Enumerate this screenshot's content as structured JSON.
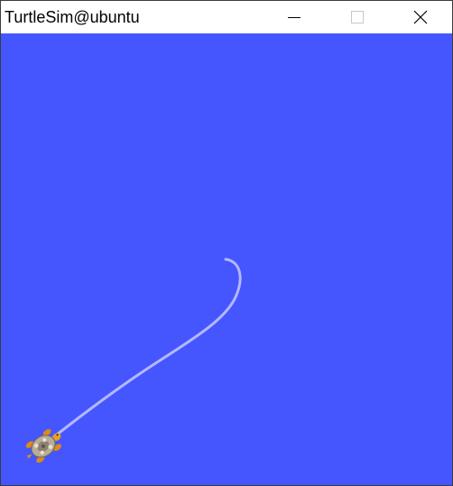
{
  "window": {
    "title": "TurtleSim@ubuntu",
    "controls": {
      "minimize_icon": "minimize-icon",
      "maximize_icon": "maximize-icon",
      "close_icon": "close-icon"
    }
  },
  "canvas": {
    "background_color": "#4556ff",
    "pen_color": "#b3b8ff"
  },
  "turtle": {
    "icon": "turtle-icon"
  }
}
